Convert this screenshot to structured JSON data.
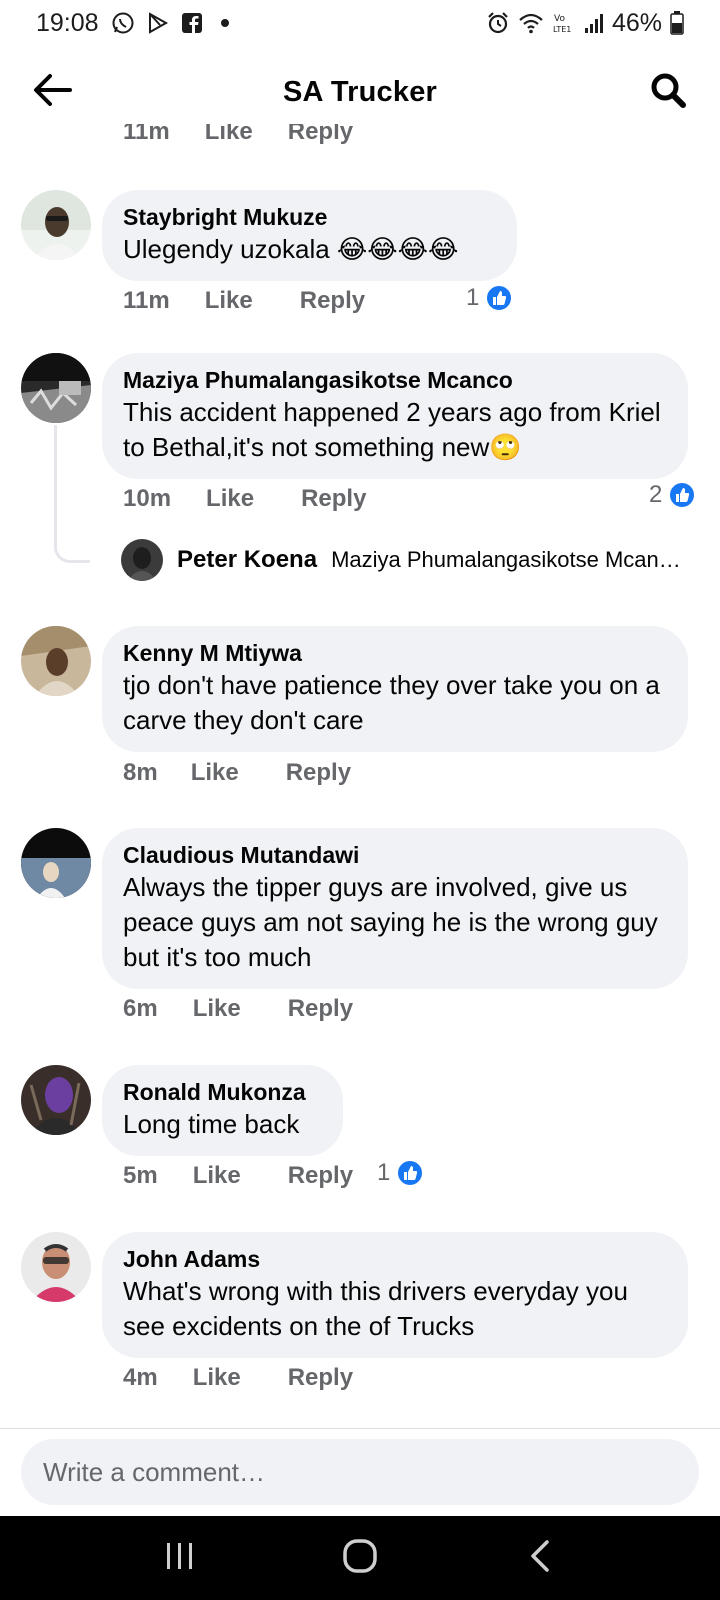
{
  "status_bar": {
    "time": "19:08",
    "battery": "46%",
    "icons_left": [
      "whatsapp-icon",
      "play-store-icon",
      "facebook-icon",
      "dot-icon"
    ],
    "icons_right": [
      "alarm-icon",
      "wifi-icon",
      "volte-icon",
      "signal-icon",
      "battery-icon"
    ]
  },
  "header": {
    "title": "SA Trucker",
    "back_icon": "arrow-left-icon",
    "search_icon": "search-icon"
  },
  "partial_actions": {
    "time": "11m",
    "like": "Like",
    "reply": "Reply"
  },
  "comments": [
    {
      "name": "Staybright Mukuze",
      "text": "Ulegendy uzokala 😂😂😂😂",
      "time": "11m",
      "like": "Like",
      "reply": "Reply",
      "reactions": "1"
    },
    {
      "name": "Maziya Phumalangasikotse Mcanco",
      "text": "This accident happened 2 years ago from Kriel to Bethal,it's not something new🙄",
      "time": "10m",
      "like": "Like",
      "reply": "Reply",
      "reactions": "2",
      "reply_preview": {
        "name": "Peter Koena",
        "text": "Maziya Phumalangasikotse Mcan…"
      }
    },
    {
      "name": "Kenny M Mtiywa",
      "text": "tjo don't have patience they over take you on a carve they don't care",
      "time": "8m",
      "like": "Like",
      "reply": "Reply"
    },
    {
      "name": "Claudious Mutandawi",
      "text": "Always the tipper guys are involved, give us peace guys am not saying he is the wrong guy but it's too much",
      "time": "6m",
      "like": "Like",
      "reply": "Reply"
    },
    {
      "name": "Ronald Mukonza",
      "text": "Long time back",
      "time": "5m",
      "like": "Like",
      "reply": "Reply",
      "reactions": "1"
    },
    {
      "name": "John Adams",
      "text": "What's wrong with this drivers everyday you see excidents on the of Trucks",
      "time": "4m",
      "like": "Like",
      "reply": "Reply"
    }
  ],
  "composer": {
    "placeholder": "Write a comment…"
  },
  "nav_bar": {
    "buttons": [
      "recent-apps-icon",
      "home-icon",
      "back-icon"
    ]
  },
  "colors": {
    "like_blue": "#1877f2",
    "bubble": "#f0f2f5",
    "meta_gray": "#65676b"
  }
}
